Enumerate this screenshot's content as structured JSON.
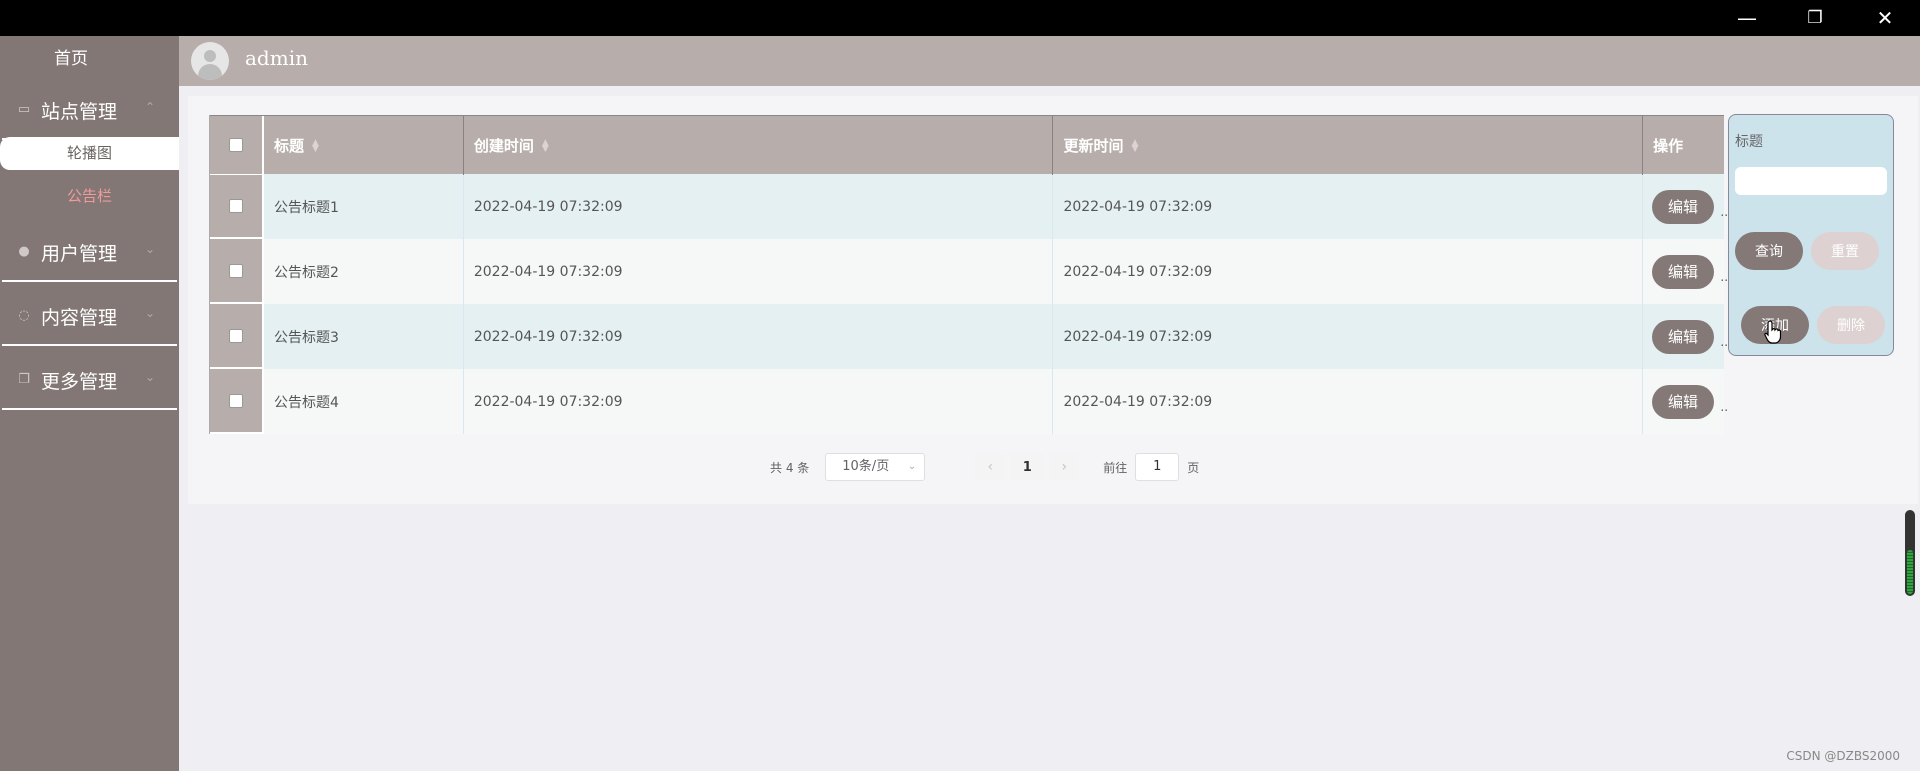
{
  "window": {
    "minimize_icon": "—",
    "restore_icon": "❐",
    "close_icon": "✕"
  },
  "sidebar": {
    "home": "首页",
    "groups": [
      {
        "label": "站点管理",
        "icon": "monitor-icon",
        "arrow": "⌃"
      },
      {
        "label": "用户管理",
        "icon": "user-icon",
        "arrow": "⌄"
      },
      {
        "label": "内容管理",
        "icon": "chat-icon",
        "arrow": "⌄"
      },
      {
        "label": "更多管理",
        "icon": "copy-icon",
        "arrow": "⌄"
      }
    ],
    "sub_items": [
      "轮播图",
      "公告栏"
    ]
  },
  "header": {
    "username": "admin"
  },
  "table": {
    "columns": [
      "标题",
      "创建时间",
      "更新时间",
      "操作"
    ],
    "rows": [
      {
        "title": "公告标题1",
        "created": "2022-04-19 07:32:09",
        "updated": "2022-04-19 07:32:09",
        "action": "编辑"
      },
      {
        "title": "公告标题2",
        "created": "2022-04-19 07:32:09",
        "updated": "2022-04-19 07:32:09",
        "action": "编辑"
      },
      {
        "title": "公告标题3",
        "created": "2022-04-19 07:32:09",
        "updated": "2022-04-19 07:32:09",
        "action": "编辑"
      },
      {
        "title": "公告标题4",
        "created": "2022-04-19 07:32:09",
        "updated": "2022-04-19 07:32:09",
        "action": "编辑"
      }
    ]
  },
  "pagination": {
    "total": "共 4 条",
    "page_size": "10条/页",
    "current_page": "1",
    "goto_label": "前往",
    "goto_value": "1",
    "page_unit": "页"
  },
  "search_panel": {
    "title_label": "标题",
    "title_value": "",
    "query_button": "查询",
    "reset_button": "重置",
    "add_button": "添加",
    "delete_button": "删除"
  },
  "watermark": "CSDN @DZBS2000"
}
